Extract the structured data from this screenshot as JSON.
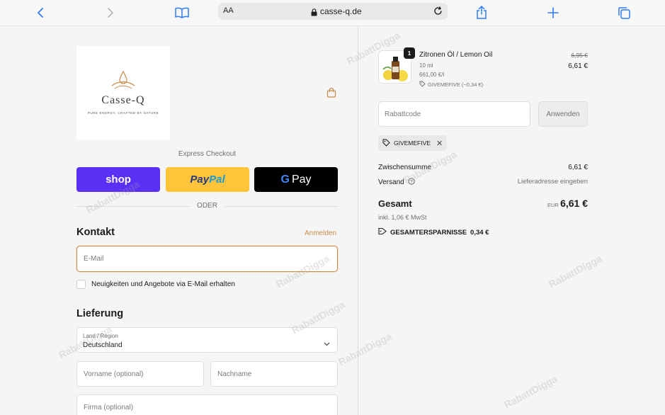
{
  "browser": {
    "text_size_label": "AA",
    "domain": "casse-q.de"
  },
  "brand": {
    "name": "Casse-Q",
    "tagline": "PURE ENERGY, CRAFTED BY NATURE"
  },
  "express": {
    "label": "Express Checkout",
    "shop_label": "shop",
    "paypal_pay": "Pay",
    "paypal_pal": "Pal",
    "gpay_g": "G",
    "gpay_label": "Pay",
    "divider": "ODER"
  },
  "contact": {
    "title": "Kontakt",
    "login": "Anmelden",
    "email_placeholder": "E-Mail",
    "newsletter_label": "Neuigkeiten und Angebote via E-Mail erhalten"
  },
  "delivery": {
    "title": "Lieferung",
    "country_label": "Land / Region",
    "country_value": "Deutschland",
    "firstname_placeholder": "Vorname (optional)",
    "lastname_placeholder": "Nachname",
    "company_placeholder": "Firma (optional)"
  },
  "summary": {
    "product": {
      "quantity": "1",
      "name": "Zitronen Öl / Lemon Oil",
      "size": "10 ml",
      "unit_price": "661,00 €/l",
      "discount": "GIVEMEFIVE (−0,34 €)",
      "old_price": "6,95 €",
      "price": "6,61 €"
    },
    "discount_placeholder": "Rabattcode",
    "apply_label": "Anwenden",
    "applied_code": "GIVEMEFIVE",
    "subtotal_label": "Zwischensumme",
    "subtotal_value": "6,61 €",
    "shipping_label": "Versand",
    "shipping_value": "Lieferadresse eingeben",
    "total_label": "Gesamt",
    "currency": "EUR",
    "total_value": "6,61 €",
    "tax": "inkl. 1,06 € MwSt",
    "savings_label": "GESAMTERSPARNISSE",
    "savings_value": "0,34 €"
  },
  "watermark": "RabattDigga",
  "colors": {
    "accent": "#c98b4a",
    "shop_pay": "#5a31f4",
    "paypal": "#ffc439",
    "browser_blue": "#2f7cf6"
  }
}
